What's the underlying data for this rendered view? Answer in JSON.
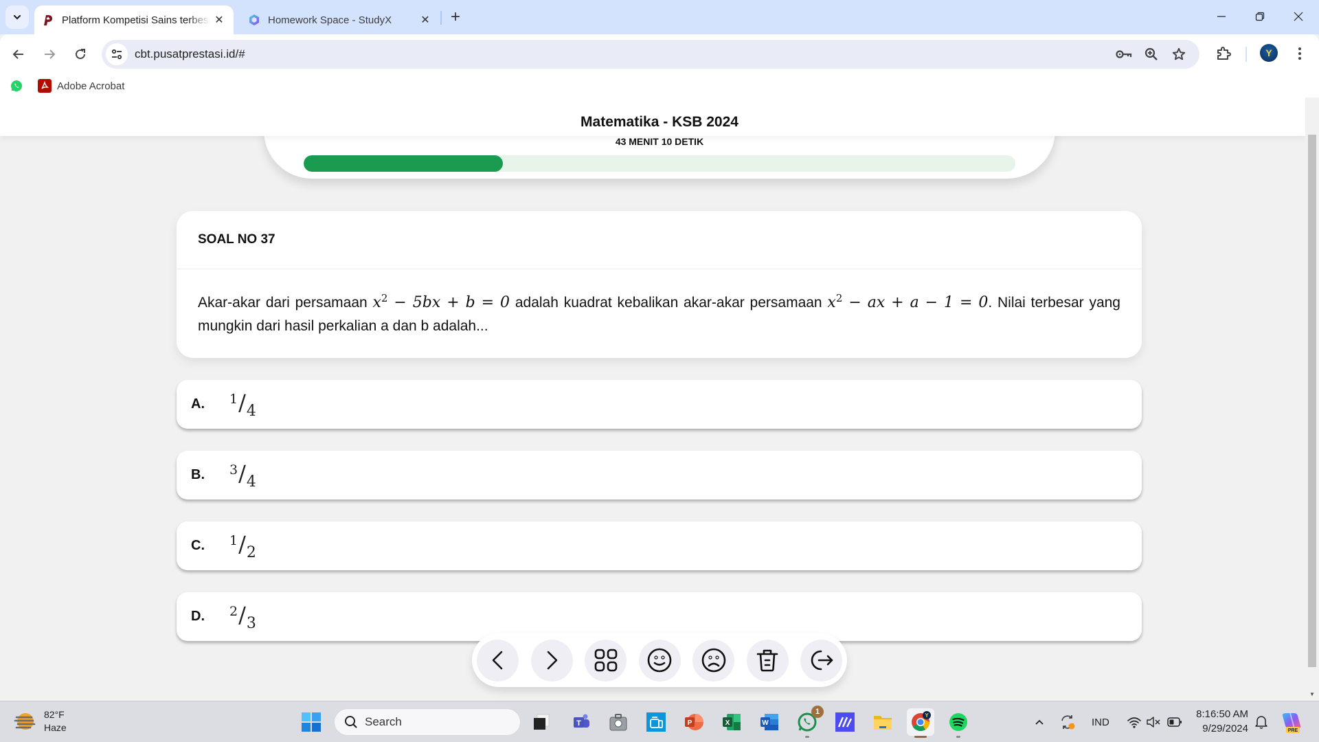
{
  "browser": {
    "tabs": [
      {
        "title": "Platform Kompetisi Sains terbesar",
        "favicon": "pusatprestasi-logo-icon",
        "active": true
      },
      {
        "title": "Homework Space - StudyX",
        "favicon": "studyx-logo-icon",
        "active": false
      }
    ],
    "url": "cbt.pusatprestasi.id/#",
    "bookmarks": [
      {
        "label": "",
        "icon": "whatsapp-icon"
      },
      {
        "label": "Adobe Acrobat",
        "icon": "adobe-acrobat-icon"
      }
    ],
    "profile_initial": "Y"
  },
  "exam": {
    "title": "Matematika - KSB 2024",
    "timer": "43 MENIT 10 DETIK",
    "progress_percent": 28,
    "accent_color": "#1a9b50",
    "track_color": "#e6f4ea"
  },
  "question": {
    "number_label": "SOAL NO 37",
    "text_parts": {
      "p1": "Akar-akar dari persamaan ",
      "eq1_a": "x",
      "eq1_sup": "2",
      "eq1_b": " − 5bx + b = 0",
      "p2": " adalah kuadrat kebalikan akar-akar persamaan ",
      "eq2_a": "x",
      "eq2_sup": "2",
      "eq2_b": " − ax + a − 1 = 0",
      "p3": ". Nilai terbesar yang mungkin dari hasil perkalian a dan b adalah..."
    }
  },
  "options": [
    {
      "letter": "A.",
      "numerator": "1",
      "denominator": "4"
    },
    {
      "letter": "B.",
      "numerator": "3",
      "denominator": "4"
    },
    {
      "letter": "C.",
      "numerator": "1",
      "denominator": "2"
    },
    {
      "letter": "D.",
      "numerator": "2",
      "denominator": "3"
    }
  ],
  "actions": [
    {
      "name": "previous-question",
      "icon": "chevron-left-icon"
    },
    {
      "name": "next-question",
      "icon": "chevron-right-icon"
    },
    {
      "name": "question-grid",
      "icon": "grid-icon"
    },
    {
      "name": "mark-sure",
      "icon": "smile-icon"
    },
    {
      "name": "mark-unsure",
      "icon": "frown-icon"
    },
    {
      "name": "clear-answer",
      "icon": "trash-icon"
    },
    {
      "name": "exit-exam",
      "icon": "logout-icon"
    }
  ],
  "taskbar": {
    "weather_temp": "82°F",
    "weather_desc": "Haze",
    "search_placeholder": "Search",
    "apps": [
      "task-view",
      "teams",
      "hp-support",
      "hp-smart",
      "powerpoint",
      "excel",
      "word",
      "whatsapp",
      "app-launcher",
      "file-explorer",
      "chrome",
      "spotify"
    ],
    "whatsapp_badge": "1",
    "language": "IND",
    "time": "8:16:50 AM",
    "date": "9/29/2024",
    "copilot_badge": "PRE"
  }
}
